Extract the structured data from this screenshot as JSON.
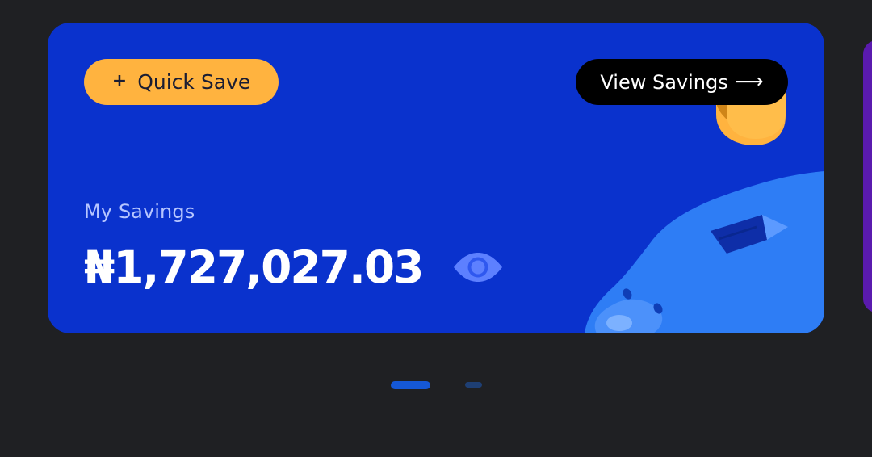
{
  "savings_card": {
    "quick_save": {
      "plus_icon": "+",
      "label": "Quick Save"
    },
    "view_savings": {
      "label": "View Savings",
      "arrow_icon": "⟶"
    },
    "title": "My Savings",
    "balance": "₦1,727,027.03",
    "visibility_icon": "eye-icon"
  },
  "carousel": {
    "active_index": 0,
    "total_slides": 2
  },
  "colors": {
    "card_background": "#0a32cd",
    "quick_save_background": "#ffb33f",
    "view_savings_background": "#000000",
    "page_background": "#202124",
    "indicator_active": "#1558d6",
    "indicator_inactive": "#1e3f74",
    "next_card_peek": "#5a1aae"
  }
}
